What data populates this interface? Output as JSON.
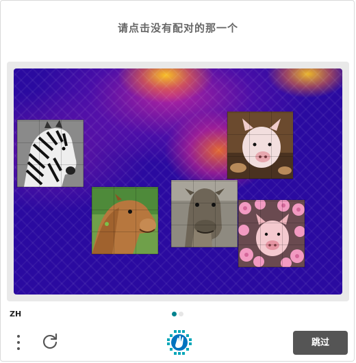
{
  "prompt": "请点击没有配对的那一个",
  "images": [
    {
      "name": "zebra",
      "role": "option"
    },
    {
      "name": "pig",
      "role": "option"
    },
    {
      "name": "camel",
      "role": "option"
    },
    {
      "name": "camel",
      "role": "option"
    },
    {
      "name": "pig",
      "role": "option"
    }
  ],
  "footer": {
    "language": "ZH",
    "page_dots": {
      "total": 2,
      "active": 1
    },
    "skip_label": "跳过"
  },
  "icons": {
    "menu": "kebab-menu-icon",
    "refresh": "refresh-icon",
    "logo": "hcaptcha-hand-logo-icon"
  },
  "colors": {
    "accent": "#00838f",
    "skip_button": "#555555",
    "prompt_text": "#666666"
  }
}
